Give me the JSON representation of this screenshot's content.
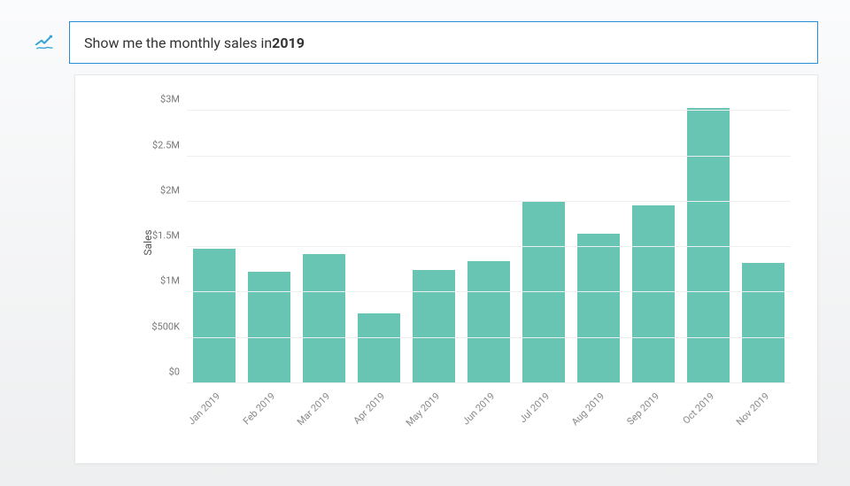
{
  "query": {
    "prefix": "Show me the monthly sales in ",
    "bold": "2019"
  },
  "chart_data": {
    "type": "bar",
    "title": "",
    "xlabel": "",
    "ylabel": "Sales",
    "categories": [
      "Jan 2019",
      "Feb 2019",
      "Mar 2019",
      "Apr 2019",
      "May 2019",
      "Jun 2019",
      "Jul 2019",
      "Aug 2019",
      "Sep 2019",
      "Oct 2019",
      "Nov 2019"
    ],
    "values": [
      1480000,
      1230000,
      1420000,
      770000,
      1250000,
      1350000,
      2010000,
      1650000,
      1960000,
      3030000,
      1330000
    ],
    "ylim": [
      0,
      3100000
    ],
    "yticks": [
      0,
      500000,
      1000000,
      1500000,
      2000000,
      2500000,
      3000000
    ],
    "ytick_labels": [
      "$0",
      "$500K",
      "$1M",
      "$1.5M",
      "$2M",
      "$2.5M",
      "$3M"
    ],
    "bar_color": "#69c5b3"
  }
}
